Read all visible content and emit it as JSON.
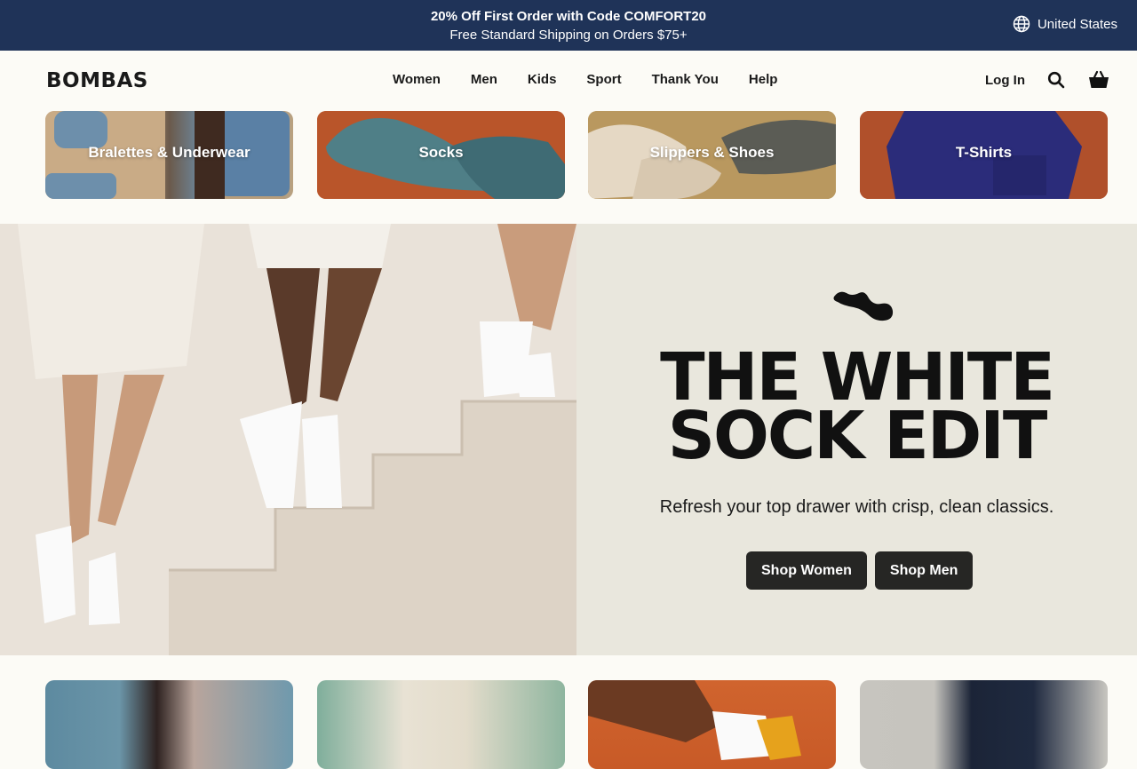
{
  "promo": {
    "line1": "20% Off First Order with Code COMFORT20",
    "line2": "Free Standard Shipping on Orders $75+",
    "locale": "United States"
  },
  "header": {
    "logo": "BOMBAS",
    "nav": [
      "Women",
      "Men",
      "Kids",
      "Sport",
      "Thank You",
      "Help"
    ],
    "login": "Log In"
  },
  "categories": [
    {
      "label": "Bralettes & Underwear"
    },
    {
      "label": "Socks"
    },
    {
      "label": "Slippers & Shoes"
    },
    {
      "label": "T-Shirts"
    }
  ],
  "hero": {
    "title_line1": "THE WHITE",
    "title_line2": "SOCK EDIT",
    "subtitle": "Refresh your top drawer with crisp, clean classics.",
    "btn_women": "Shop Women",
    "btn_men": "Shop Men"
  },
  "colors": {
    "promo_bg": "#1f3358",
    "page_bg": "#fcfbf6",
    "hero_panel_bg": "#e9e7dd",
    "button_bg": "#262624"
  },
  "icons": {
    "locale": "globe-icon",
    "search": "search-icon",
    "cart": "shopping-basket-icon",
    "hero": "sock-icon"
  }
}
